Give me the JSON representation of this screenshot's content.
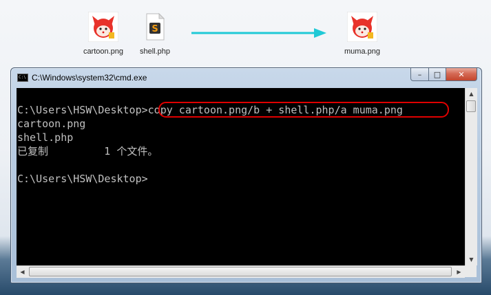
{
  "desktop": {
    "icons": [
      {
        "label": "cartoon.png",
        "icon": "fox-image-icon"
      },
      {
        "label": "shell.php",
        "icon": "php-file-icon"
      },
      {
        "label": "muma.png",
        "icon": "fox-image-icon"
      }
    ],
    "arrow_color": "#1fc9d6"
  },
  "window": {
    "title": "C:\\Windows\\system32\\cmd.exe",
    "controls": {
      "minimize": "–",
      "maximize": "□",
      "close": "✕"
    }
  },
  "console": {
    "lines": [
      "C:\\Users\\HSW\\Desktop>copy cartoon.png/b + shell.php/a muma.png",
      "cartoon.png",
      "shell.php",
      "已复制         1 个文件。",
      "C:\\Users\\HSW\\Desktop>"
    ],
    "highlight_color": "#e00000"
  }
}
